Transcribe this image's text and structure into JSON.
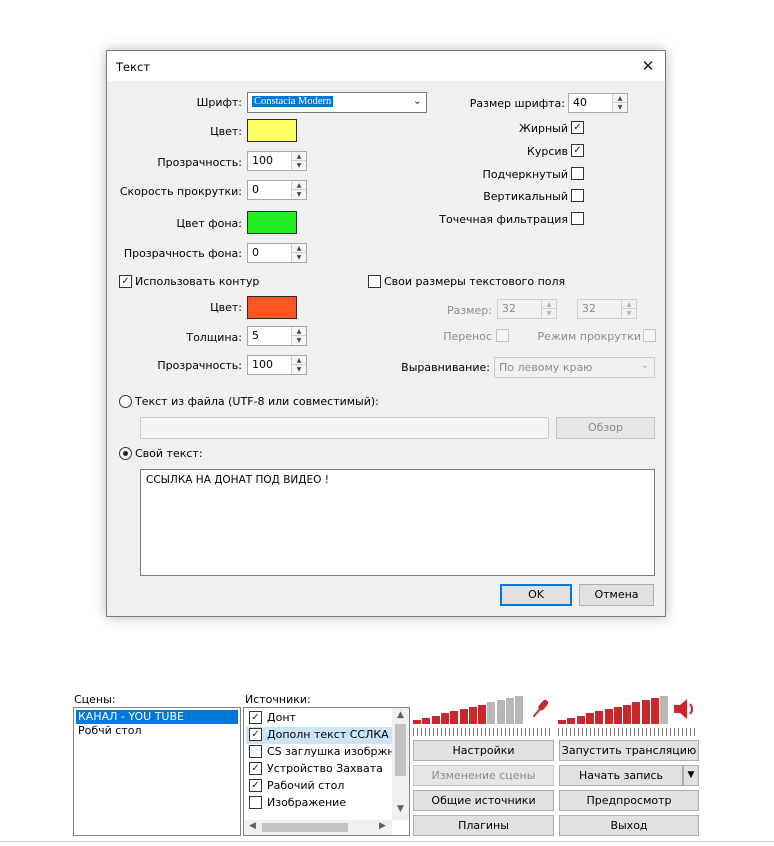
{
  "dialog": {
    "title": "Текст",
    "font_label": "Шрифт:",
    "font_value": "Constacia Modern",
    "font_size_label": "Размер шрифта:",
    "font_size_value": "40",
    "color_label": "Цвет:",
    "color_value": "#ffff66",
    "opacity_label": "Прозрачность:",
    "opacity_value": "100",
    "scroll_speed_label": "Скорость прокрутки:",
    "scroll_speed_value": "0",
    "bg_color_label": "Цвет фона:",
    "bg_color_value": "#22ee22",
    "bg_opacity_label": "Прозрачность фона:",
    "bg_opacity_value": "0",
    "bold_label": "Жирный",
    "italic_label": "Курсив",
    "underline_label": "Подчеркнутый",
    "vertical_label": "Вертикальный",
    "point_filter_label": "Точечная фильтрация",
    "outline_label": "Использовать контур",
    "outline_color_label": "Цвет:",
    "outline_color_value": "#ff5522",
    "thickness_label": "Толщина:",
    "thickness_value": "5",
    "outline_opacity_label": "Прозрачность:",
    "outline_opacity_value": "100",
    "custom_size_label": "Свои размеры текстового поля",
    "size_label": "Размер:",
    "size_w": "32",
    "size_h": "32",
    "wrap_label": "Перенос",
    "scroll_mode_label": "Режим прокрутки",
    "align_label": "Выравнивание:",
    "align_value": "По левому краю",
    "from_file_label": "Текст из файла (UTF-8 или совместимый):",
    "browse_label": "Обзор",
    "custom_text_label": "Свой текст:",
    "custom_text_value": "ССЫЛКА НА ДОНАТ ПОД ВИДЕО !",
    "ok_label": "OK",
    "cancel_label": "Отмена"
  },
  "scenes": {
    "label": "Сцены:",
    "items": [
      "КАНАЛ - YOU TUBE",
      "Робчй стол"
    ]
  },
  "sources": {
    "label": "Источники:",
    "items": [
      "Донт",
      "Дополн текст ССЛКА В",
      "CS заглушка изобржне",
      "Устройство Захвата",
      "Рабочий стол",
      "Изображение"
    ]
  },
  "buttons": {
    "settings": "Настройки",
    "edit_scene": "Изменение сцены",
    "global_sources": "Общие источники",
    "plugins": "Плагины",
    "start_stream": "Запустить трансляцию",
    "start_record": "Начать запись",
    "preview": "Предпросмотр",
    "exit": "Выход"
  },
  "meters": {
    "mic_level": 0.7,
    "speaker_level": 0.9
  },
  "colors": {
    "accent": "#0078d7",
    "meter_red": "#c9272b",
    "meter_gray": "#b8b8b8"
  },
  "icons": {
    "mic": "microphone-icon",
    "speaker": "speaker-icon"
  }
}
